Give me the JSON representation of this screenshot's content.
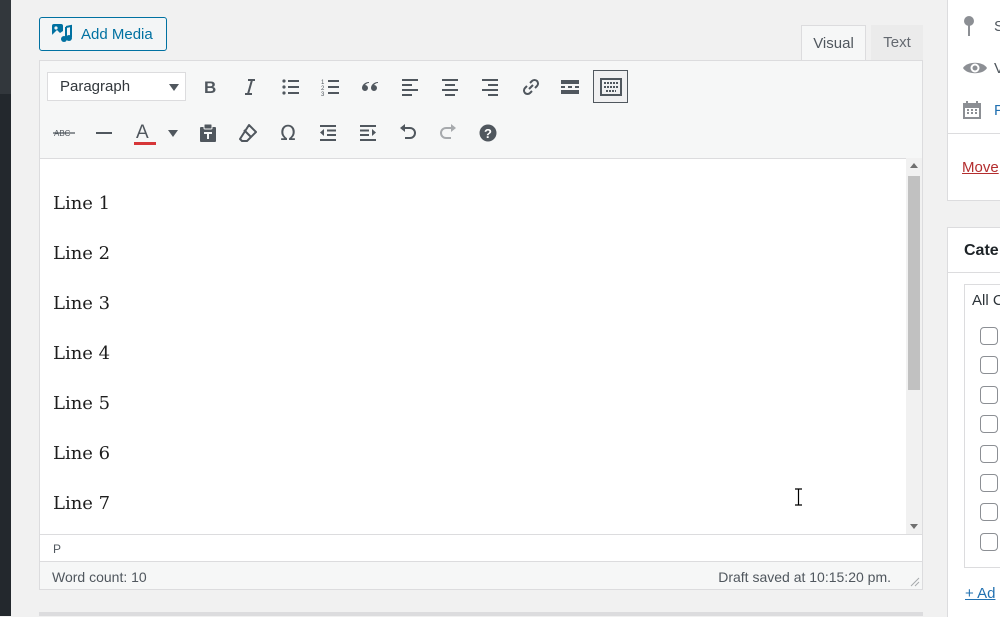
{
  "media": {
    "add_label": "Add Media"
  },
  "editor_tabs": {
    "visual": "Visual",
    "text": "Text"
  },
  "toolbar": {
    "format_value": "Paragraph",
    "buttons_row1": [
      "bold-icon",
      "italic-icon",
      "bulleted-list-icon",
      "numbered-list-icon",
      "blockquote-icon",
      "align-left-icon",
      "align-center-icon",
      "align-right-icon",
      "insert-link-icon",
      "read-more-icon",
      "toolbar-toggle-icon"
    ],
    "buttons_row2": [
      "strikethrough-icon",
      "horizontal-line-icon",
      "text-color-icon",
      "paste-as-text-icon",
      "clear-formatting-icon",
      "special-character-icon",
      "outdent-icon",
      "indent-icon",
      "undo-icon",
      "redo-icon",
      "keyboard-shortcuts-icon"
    ],
    "strike_label": "ABC",
    "text_color_label": "A",
    "omega_label": "Ω",
    "text_color": "#d63638"
  },
  "content": {
    "lines": [
      "Line 1",
      "Line 2",
      "Line 3",
      "Line 4",
      "Line 5",
      "Line 6",
      "Line 7"
    ]
  },
  "statusbar": {
    "path": "P",
    "word_count": "Word count: 10",
    "draft_saved": "Draft saved at 10:15:20 pm."
  },
  "publish_box": {
    "status_initial": "S",
    "visibility_initial": "V",
    "publish_initial": "P",
    "move_to_trash": "Move"
  },
  "categories": {
    "title": "Cate",
    "tab_all": "All C",
    "checkbox_count": 8,
    "add_new": "+ Ad"
  },
  "colors": {
    "accent": "#0071a1",
    "link": "#2271b1",
    "trash": "#b32d2e"
  }
}
